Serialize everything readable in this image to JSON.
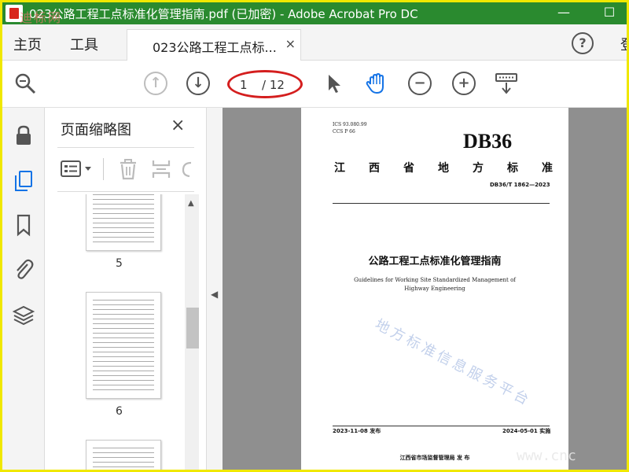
{
  "window": {
    "title": "023公路工程工点标准化管理指南.pdf (已加密) - Adobe Acrobat Pro DC",
    "corner_watermark": "迪标网",
    "minimize": "—",
    "maximize": "☐"
  },
  "menubar": {
    "home": "主页",
    "tools": "工具",
    "doc_tab": "023公路工程工点标...",
    "tab_close": "×",
    "help": "?",
    "right_cut": "登"
  },
  "toolbar": {
    "page_current": "1",
    "page_total": "/ 12",
    "highlight_color": "#d41e1e"
  },
  "panel": {
    "title": "页面缩略图",
    "close": "×",
    "thumbnails": [
      {
        "label": "5"
      },
      {
        "label": "6"
      }
    ]
  },
  "document": {
    "ics": "ICS  93.080.99",
    "ccs": "CCS  P  66",
    "db": "DB36",
    "standard_type": "江西省地方标准",
    "code": "DB36/T  1862—2023",
    "title_zh": "公路工程工点标准化管理指南",
    "title_en": "Guidelines for Working Site Standardized Management of Highway Engineering",
    "issue_date": "2023-11-08 发布",
    "impl_date": "2024-05-01 实施",
    "issuer": "江西省市场监督管理局    发 布",
    "watermark": "地方标准信息服务平台",
    "url_watermark": "www.cnc"
  },
  "colors": {
    "titlebar": "#2a8a2f",
    "frame": "#f0e800",
    "accent_blue": "#1473e6"
  }
}
